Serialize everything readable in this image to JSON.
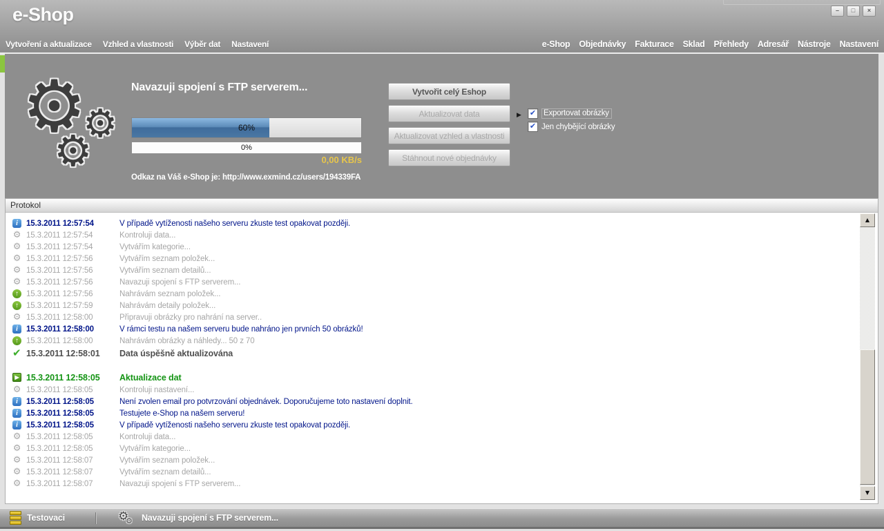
{
  "window": {
    "title": "e-Shop",
    "controls": [
      {
        "name": "minimize",
        "glyph": "–"
      },
      {
        "name": "maximize",
        "glyph": "□"
      },
      {
        "name": "close",
        "glyph": "×"
      }
    ]
  },
  "menu": {
    "left": [
      {
        "label": "Vytvoření a aktualizace"
      },
      {
        "label": "Vzhled a vlastnosti"
      },
      {
        "label": "Výběr dat"
      },
      {
        "label": "Nastavení"
      }
    ],
    "right": [
      {
        "label": "e-Shop"
      },
      {
        "label": "Objednávky"
      },
      {
        "label": "Fakturace"
      },
      {
        "label": "Sklad"
      },
      {
        "label": "Přehledy"
      },
      {
        "label": "Adresář"
      },
      {
        "label": "Nástroje"
      },
      {
        "label": "Nastavení"
      }
    ]
  },
  "main": {
    "status_heading": "Navazuji spojení s FTP serverem...",
    "progress_primary": {
      "percent": 60,
      "label": "60%"
    },
    "progress_secondary": {
      "percent": 0,
      "label": "0%"
    },
    "speed": "0,00 KB/s",
    "shop_link": "Odkaz na Váš e-Shop je: http://www.exmind.cz/users/194339FA",
    "buttons": [
      {
        "label": "Vytvořit celý Eshop",
        "enabled": true
      },
      {
        "label": "Aktualizovat data",
        "enabled": false
      },
      {
        "label": "Aktualizovat vzhled a vlastnosti",
        "enabled": false
      },
      {
        "label": "Stáhnout nové objednávky",
        "enabled": false
      }
    ],
    "checkboxes": [
      {
        "label": "Exportovat obrázky",
        "checked": true,
        "focused": true
      },
      {
        "label": "Jen chybějící obrázky",
        "checked": true,
        "focused": false
      }
    ]
  },
  "protocol": {
    "title": "Protokol",
    "entries": [
      {
        "type": "info",
        "time": "15.3.2011 12:57:54",
        "text": "V případě vytíženosti našeho serveru zkuste test opakovat později."
      },
      {
        "type": "task",
        "time": "15.3.2011 12:57:54",
        "text": "Kontroluji data..."
      },
      {
        "type": "task",
        "time": "15.3.2011 12:57:54",
        "text": "Vytvářím kategorie..."
      },
      {
        "type": "task",
        "time": "15.3.2011 12:57:56",
        "text": "Vytvářím seznam položek..."
      },
      {
        "type": "task",
        "time": "15.3.2011 12:57:56",
        "text": "Vytvářím seznam detailů..."
      },
      {
        "type": "task",
        "time": "15.3.2011 12:57:56",
        "text": "Navazuji spojení s FTP serverem..."
      },
      {
        "type": "upload",
        "time": "15.3.2011 12:57:56",
        "text": "Nahrávám seznam položek..."
      },
      {
        "type": "upload",
        "time": "15.3.2011 12:57:59",
        "text": "Nahrávám detaily položek..."
      },
      {
        "type": "task",
        "time": "15.3.2011 12:58:00",
        "text": "Připravuji obrázky pro nahrání na server.."
      },
      {
        "type": "info",
        "time": "15.3.2011 12:58:00",
        "text": "V rámci testu na našem serveru bude nahráno jen prvních 50 obrázků!"
      },
      {
        "type": "upload",
        "time": "15.3.2011 12:58:00",
        "text": "Nahrávám obrázky a náhledy... 50 z 70"
      },
      {
        "type": "success",
        "time": "15.3.2011 12:58:01",
        "text": "Data úspěšně aktualizována"
      },
      {
        "type": "start",
        "time": "15.3.2011 12:58:05",
        "text": "Aktualizace dat",
        "gap_before": true
      },
      {
        "type": "task",
        "time": "15.3.2011 12:58:05",
        "text": "Kontroluji nastavení..."
      },
      {
        "type": "info",
        "time": "15.3.2011 12:58:05",
        "text": "Není zvolen email pro potvrzování objednávek. Doporučujeme toto nastavení doplnit."
      },
      {
        "type": "info",
        "time": "15.3.2011 12:58:05",
        "text": "Testujete e-Shop na našem serveru!"
      },
      {
        "type": "info",
        "time": "15.3.2011 12:58:05",
        "text": "V případě vytíženosti našeho serveru zkuste test opakovat později."
      },
      {
        "type": "task",
        "time": "15.3.2011 12:58:05",
        "text": "Kontroluji data..."
      },
      {
        "type": "task",
        "time": "15.3.2011 12:58:05",
        "text": "Vytvářím kategorie..."
      },
      {
        "type": "task",
        "time": "15.3.2011 12:58:07",
        "text": "Vytvářím seznam položek..."
      },
      {
        "type": "task",
        "time": "15.3.2011 12:58:07",
        "text": "Vytvářím seznam detailů..."
      },
      {
        "type": "task",
        "time": "15.3.2011 12:58:07",
        "text": "Navazuji spojení s FTP serverem..."
      }
    ]
  },
  "statusbar": {
    "profile": "Testovaci",
    "status": "Navazuji spojení s FTP serverem..."
  },
  "icons": {
    "info": "i",
    "task": "⚙",
    "upload": "↑",
    "success": "✔",
    "start": "▶",
    "submenu_arrow": "▶",
    "check_mark": "✔",
    "scroll_up": "▲",
    "scroll_down": "▼"
  },
  "colors": {
    "accent_green": "#8bc53f",
    "progress_blue": "#4f81b4",
    "speed_yellow": "#e8c64b",
    "info_navy": "#001489",
    "success_green": "#149414"
  }
}
